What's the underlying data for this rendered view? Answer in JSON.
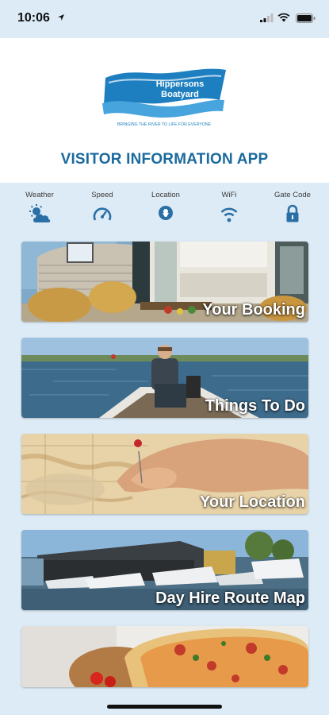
{
  "status_bar": {
    "time": "10:06"
  },
  "header": {
    "logo": {
      "name_line1": "Hippersons",
      "name_line2": "Boatyard",
      "tagline": "BRINGING THE RIVER TO LIFE FOR EVERYONE"
    },
    "title": "VISITOR INFORMATION APP"
  },
  "quick_links": [
    {
      "label": "Weather",
      "icon": "weather-icon"
    },
    {
      "label": "Speed",
      "icon": "speedometer-icon"
    },
    {
      "label": "Location",
      "icon": "location-pin-icon"
    },
    {
      "label": "WiFi",
      "icon": "wifi-icon"
    },
    {
      "label": "Gate Code",
      "icon": "lock-icon"
    }
  ],
  "tiles": [
    {
      "label": "Your Booking"
    },
    {
      "label": "Things To Do"
    },
    {
      "label": "Your Location"
    },
    {
      "label": "Day Hire Route Map"
    },
    {
      "label": ""
    }
  ],
  "colors": {
    "background": "#ddebf6",
    "title": "#1a6a9e",
    "icon": "#2a6fa5"
  }
}
